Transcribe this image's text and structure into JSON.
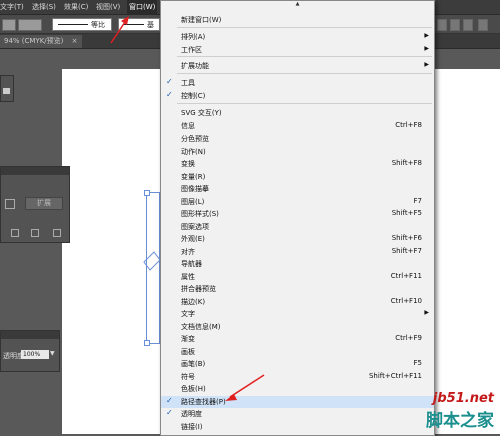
{
  "menubar": {
    "items": [
      "文字(T)",
      "选择(S)",
      "效果(C)",
      "视图(V)",
      "窗口(W)"
    ],
    "active_index": 4
  },
  "toolbar": {
    "stroke_label": "等比",
    "stroke_label2": "基"
  },
  "document": {
    "tab_title": "94% (CMYK/预览)",
    "tab_close": "×"
  },
  "panel_mid": {
    "button_label": "扩展"
  },
  "panel_bottom": {
    "opacity_label": "透明度",
    "opacity_value": "100%"
  },
  "menu": {
    "scroll_up": "▲",
    "items": [
      {
        "label": "新建窗口(W)"
      },
      {
        "label": "排列(A)",
        "submenu": true
      },
      {
        "label": "工作区",
        "submenu": true
      },
      {
        "label": "扩展功能",
        "submenu": true
      },
      {
        "label": "工具",
        "checked": true
      },
      {
        "label": "控制(C)",
        "checked": true
      },
      {
        "label": "SVG 交互(Y)"
      },
      {
        "label": "信息",
        "shortcut": "Ctrl+F8"
      },
      {
        "label": "分色预览"
      },
      {
        "label": "动作(N)"
      },
      {
        "label": "变换",
        "shortcut": "Shift+F8"
      },
      {
        "label": "变量(R)"
      },
      {
        "label": "图像描摹"
      },
      {
        "label": "图层(L)",
        "shortcut": "F7"
      },
      {
        "label": "图形样式(S)",
        "shortcut": "Shift+F5"
      },
      {
        "label": "图案选项"
      },
      {
        "label": "外观(E)",
        "shortcut": "Shift+F6"
      },
      {
        "label": "对齐",
        "shortcut": "Shift+F7"
      },
      {
        "label": "导航器"
      },
      {
        "label": "属性",
        "shortcut": "Ctrl+F11"
      },
      {
        "label": "拼合器预览"
      },
      {
        "label": "描边(K)",
        "shortcut": "Ctrl+F10"
      },
      {
        "label": "文字",
        "submenu": true
      },
      {
        "label": "文档信息(M)"
      },
      {
        "label": "渐变",
        "shortcut": "Ctrl+F9"
      },
      {
        "label": "画板"
      },
      {
        "label": "画笔(B)",
        "shortcut": "F5"
      },
      {
        "label": "符号",
        "shortcut": "Shift+Ctrl+F11"
      },
      {
        "label": "色板(H)"
      },
      {
        "label": "路径查找器(P)",
        "checked": true,
        "highlighted": true
      },
      {
        "label": "透明度",
        "checked": true
      },
      {
        "label": "链接(I)"
      }
    ]
  },
  "watermark": {
    "line1": "jb51.net",
    "line2": "脚本之家"
  },
  "colors": {
    "menu_bg": "#f1f1f1",
    "check": "#1a5fb4",
    "highlight": "#cfe2f7",
    "arrow": "#e02020"
  }
}
